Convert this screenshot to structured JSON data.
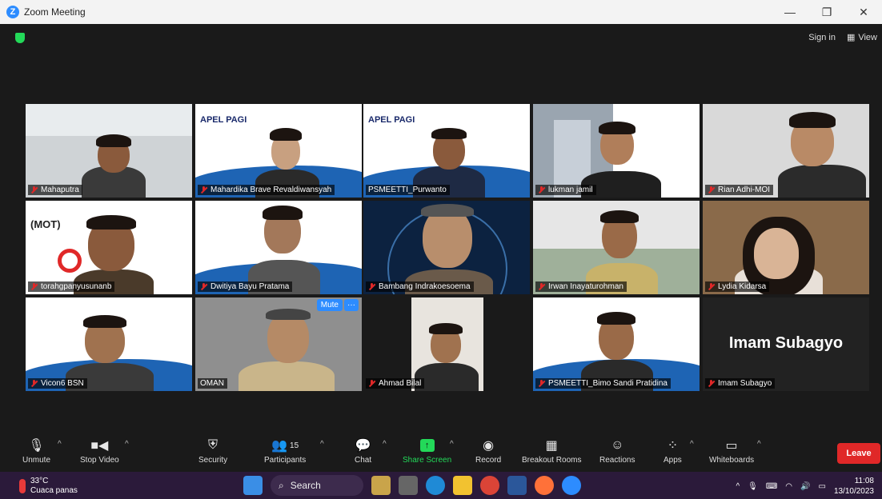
{
  "window": {
    "title": "Zoom Meeting",
    "minimize": "—",
    "restore": "❐",
    "close": "✕"
  },
  "topbar": {
    "sign_in": "Sign in",
    "view": "View"
  },
  "participants": [
    {
      "name": "Mahaputra"
    },
    {
      "name": "Mahardika Brave Revaldiwansyah",
      "banner": "APEL PAGI"
    },
    {
      "name": "PSMEETTI_Purwanto",
      "banner": "APEL PAGI"
    },
    {
      "name": "lukman jamil"
    },
    {
      "name": "Rian Adhi-MOI"
    },
    {
      "name": "torahgpanyusunanb",
      "banner": "(MOT)"
    },
    {
      "name": "Dwitiya Bayu Pratama"
    },
    {
      "name": "Bambang Indrakoesoema"
    },
    {
      "name": "Irwan Inayaturohman"
    },
    {
      "name": "Lydia Kidarsa"
    },
    {
      "name": "Vicon6 BSN"
    },
    {
      "name": "OMAN",
      "mute_button": "Mute",
      "more_button": "···"
    },
    {
      "name": "Ahmad Bilal"
    },
    {
      "name": "PSMEETTI_Bimo Sandi Pratidina"
    },
    {
      "name": "Imam Subagyo",
      "display_name": "Imam Subagyo"
    }
  ],
  "toolbar": {
    "unmute": "Unmute",
    "stop_video": "Stop Video",
    "security": "Security",
    "participants": "Participants",
    "participants_count": "15",
    "chat": "Chat",
    "share_screen": "Share Screen",
    "record": "Record",
    "breakout_rooms": "Breakout Rooms",
    "reactions": "Reactions",
    "apps": "Apps",
    "whiteboards": "Whiteboards",
    "leave": "Leave"
  },
  "taskbar": {
    "temperature": "33°C",
    "weather": "Cuaca panas",
    "search": "Search",
    "time": "11:08",
    "date": "13/10/2023"
  },
  "colors": {
    "zoom_blue": "#2d8cff",
    "leave_red": "#e02828",
    "share_green": "#23d959",
    "active_speaker": "#c8e63c"
  }
}
